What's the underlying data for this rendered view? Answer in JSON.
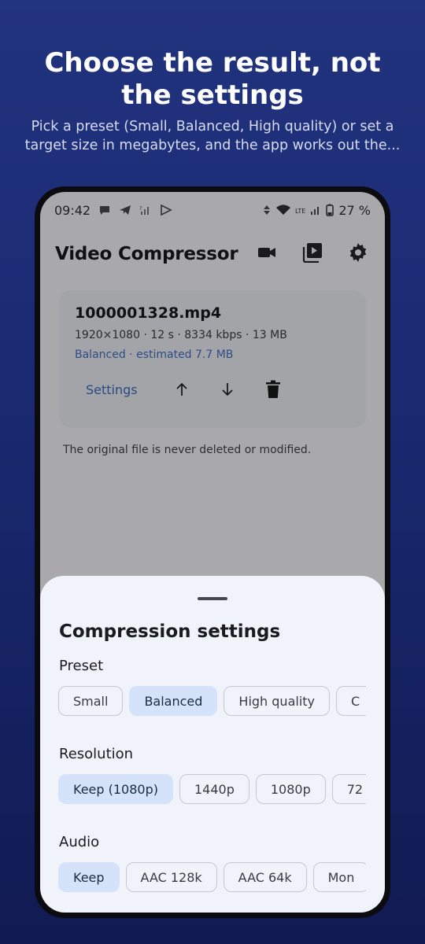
{
  "promo": {
    "headline": "Choose the result, not the settings",
    "subhead": "Pick a preset (Small, Balanced, High quality) or set a target size in megabytes, and the app works out the..."
  },
  "status_bar": {
    "time": "09:42",
    "battery": "27 %",
    "network": "LTE"
  },
  "app_bar": {
    "title": "Video Compressor",
    "icons": [
      "video-camera-icon",
      "video-library-icon",
      "gear-icon"
    ]
  },
  "file_card": {
    "filename": "1000001328.mp4",
    "info": "1920×1080 · 12 s · 8334 kbps · 13 MB",
    "estimate": "Balanced · estimated 7.7 MB",
    "settings_label": "Settings"
  },
  "note": "The original file is never deleted or modified.",
  "sheet": {
    "title": "Compression settings",
    "preset": {
      "label": "Preset",
      "options": [
        "Small",
        "Balanced",
        "High quality",
        "C"
      ],
      "selected": "Balanced"
    },
    "resolution": {
      "label": "Resolution",
      "options": [
        "Keep (1080p)",
        "1440p",
        "1080p",
        "72"
      ],
      "selected": "Keep (1080p)"
    },
    "audio": {
      "label": "Audio",
      "options": [
        "Keep",
        "AAC 128k",
        "AAC 64k",
        "Mon"
      ],
      "selected": "Keep"
    }
  },
  "colors": {
    "accent": "#2a4a82",
    "chip_selected": "#d4e3f9",
    "sheet_bg": "#f1f3fa"
  }
}
